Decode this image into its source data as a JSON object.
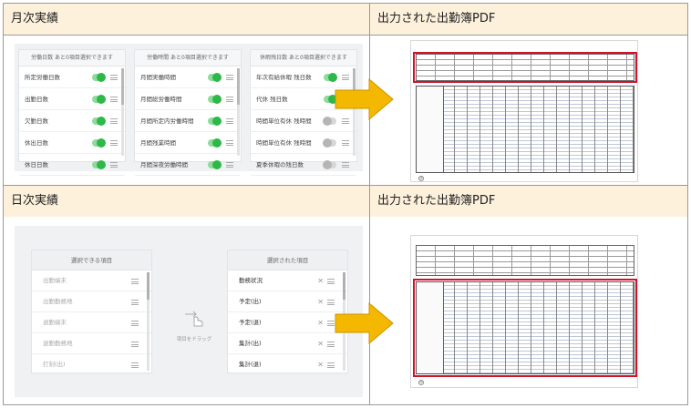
{
  "sections": {
    "monthly": {
      "title": "月次実績"
    },
    "daily": {
      "title": "日次実績"
    },
    "output_top": {
      "title": "出力された出勤簿PDF"
    },
    "output_bottom": {
      "title": "出力された出勤簿PDF"
    }
  },
  "monthly_columns": [
    {
      "header": "労働日数 あと0項目選択できます",
      "items": [
        {
          "label": "所定労働日数",
          "on": true
        },
        {
          "label": "出勤日数",
          "on": true
        },
        {
          "label": "欠勤日数",
          "on": true
        },
        {
          "label": "休出日数",
          "on": true
        },
        {
          "label": "休日日数",
          "on": true
        }
      ]
    },
    {
      "header": "労働時間 あと0項目選択できます",
      "items": [
        {
          "label": "月間実働時間",
          "on": true
        },
        {
          "label": "月間総労働時間",
          "on": true
        },
        {
          "label": "月間所定内労働時間",
          "on": true
        },
        {
          "label": "月間残業時間",
          "on": true
        },
        {
          "label": "月間深夜労働時間",
          "on": true
        }
      ]
    },
    {
      "header": "休暇残日数 あと0項目選択できます",
      "items": [
        {
          "label": "年次有給休暇 残日数",
          "on": true
        },
        {
          "label": "代休 残日数",
          "on": true
        },
        {
          "label": "時間単位有休 残時間",
          "on": false
        },
        {
          "label": "時間単位有休 残時間",
          "on": false
        },
        {
          "label": "夏季休暇の残日数",
          "on": false
        }
      ]
    }
  ],
  "daily_available": {
    "header": "選択できる項目",
    "items": [
      "出勤端末",
      "出勤勤務地",
      "退勤端末",
      "退勤勤務地",
      "打刻(出)"
    ]
  },
  "drag_hint": "項目をドラッグ",
  "daily_selected": {
    "header": "選択された項目",
    "items": [
      "勤務状況",
      "予定(出)",
      "予定(退)",
      "集計(出)",
      "集計(退)"
    ]
  },
  "pdf": {
    "page_mark": "②"
  },
  "colors": {
    "header_bg": "#fdf1dc",
    "arrow": "#f5b800",
    "highlight": "#d0122a",
    "toggle_on": "#2fb84a"
  }
}
